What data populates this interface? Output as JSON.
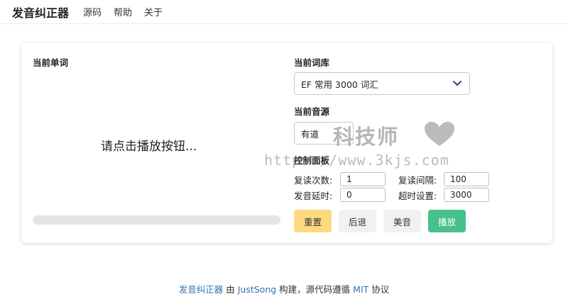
{
  "nav": {
    "brand": "发音纠正器",
    "links": [
      "源码",
      "帮助",
      "关于"
    ]
  },
  "word_panel": {
    "title": "当前单词",
    "prompt": "请点击播放按钮...",
    "progress": 0
  },
  "dictionary": {
    "title": "当前词库",
    "selected": "EF 常用 3000 词汇"
  },
  "audio_source": {
    "title": "当前音源",
    "selected": "有道"
  },
  "control_panel": {
    "title": "控制面板",
    "repeat_count_label": "复读次数:",
    "repeat_count_value": "1",
    "repeat_interval_label": "复读间隔:",
    "repeat_interval_value": "100",
    "delay_label": "发音延时:",
    "delay_value": "0",
    "timeout_label": "超时设置:",
    "timeout_value": "3000"
  },
  "buttons": {
    "reset": "重置",
    "back": "后退",
    "us": "美音",
    "play": "播放"
  },
  "watermark": {
    "title": "科技师",
    "url": "https://www.3kjs.com"
  },
  "footer": {
    "project": "发音纠正器",
    "by": " 由 ",
    "author": "JustSong",
    "middle": " 构建，源代码遵循 ",
    "license": "MIT",
    "suffix": " 协议"
  },
  "colors": {
    "reset_button": "#fdd980",
    "play_button": "#47c18a",
    "link": "#3572b0"
  }
}
